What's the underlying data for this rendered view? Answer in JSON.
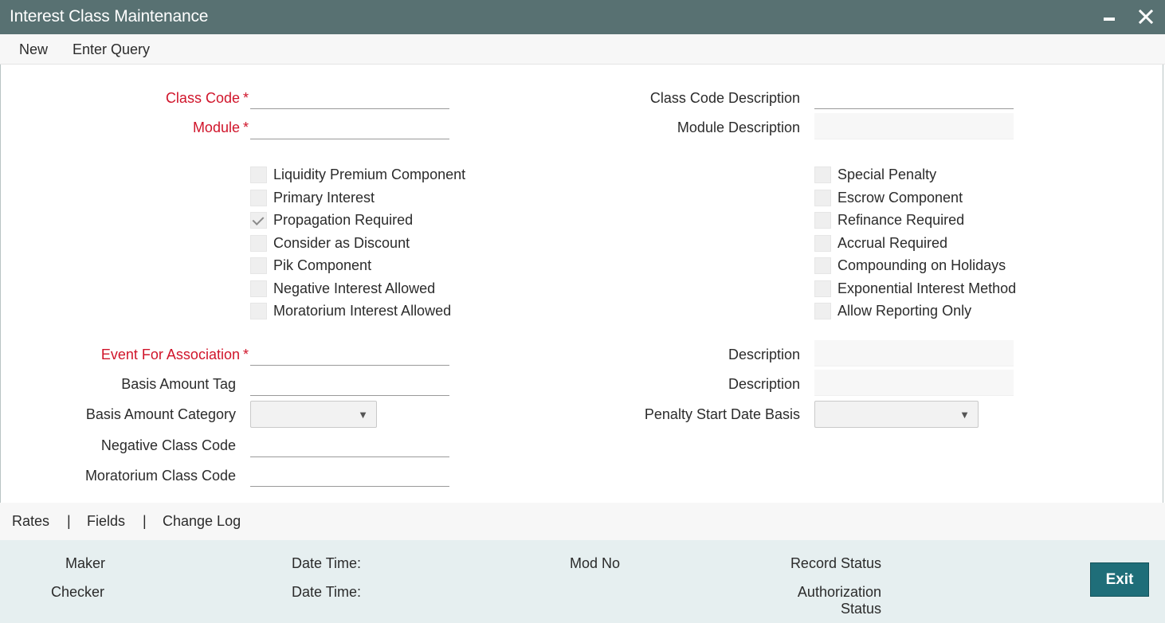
{
  "window": {
    "title": "Interest Class Maintenance",
    "minimize_icon": "minimize-icon",
    "close_icon": "close-icon"
  },
  "menu": {
    "new_label": "New",
    "enter_query_label": "Enter Query"
  },
  "fields": {
    "class_code": {
      "label": "Class Code",
      "required_mark": "*",
      "value": ""
    },
    "class_code_description": {
      "label": "Class Code Description",
      "value": ""
    },
    "module": {
      "label": "Module",
      "required_mark": "*",
      "value": ""
    },
    "module_description": {
      "label": "Module Description",
      "value": ""
    },
    "event_for_association": {
      "label": "Event For Association",
      "required_mark": "*",
      "value": ""
    },
    "event_description": {
      "label": "Description",
      "value": ""
    },
    "basis_amount_tag": {
      "label": "Basis Amount Tag",
      "value": ""
    },
    "basis_amount_tag_description": {
      "label": "Description",
      "value": ""
    },
    "basis_amount_category": {
      "label": "Basis Amount Category",
      "selected": ""
    },
    "penalty_start_date_basis": {
      "label": "Penalty Start Date Basis",
      "selected": ""
    },
    "negative_class_code": {
      "label": "Negative Class Code",
      "value": ""
    },
    "moratorium_class_code": {
      "label": "Moratorium Class Code",
      "value": ""
    }
  },
  "checkboxes_left": [
    {
      "label": "Liquidity Premium Component",
      "checked": false
    },
    {
      "label": "Primary Interest",
      "checked": false
    },
    {
      "label": "Propagation Required",
      "checked": true
    },
    {
      "label": "Consider as Discount",
      "checked": false
    },
    {
      "label": "Pik Component",
      "checked": false
    },
    {
      "label": "Negative Interest Allowed",
      "checked": false
    },
    {
      "label": "Moratorium Interest Allowed",
      "checked": false
    }
  ],
  "checkboxes_right": [
    {
      "label": "Special Penalty",
      "checked": false
    },
    {
      "label": "Escrow Component",
      "checked": false
    },
    {
      "label": "Refinance Required",
      "checked": false
    },
    {
      "label": "Accrual Required",
      "checked": false
    },
    {
      "label": "Compounding on Holidays",
      "checked": false
    },
    {
      "label": "Exponential Interest Method",
      "checked": false
    },
    {
      "label": "Allow Reporting Only",
      "checked": false
    }
  ],
  "subtabs": {
    "rates": "Rates",
    "fields": "Fields",
    "change_log": "Change Log",
    "separator": "|"
  },
  "footer": {
    "maker": "Maker",
    "checker": "Checker",
    "date_time_1": "Date Time:",
    "date_time_2": "Date Time:",
    "mod_no": "Mod No",
    "record_status": "Record Status",
    "authorization_status_line1": "Authorization",
    "authorization_status_line2": "Status",
    "exit_label": "Exit"
  },
  "colors": {
    "titlebar": "#587172",
    "required_label": "#d0142a",
    "exit_button": "#1f6e79",
    "footer_bg": "#e6eff0"
  }
}
